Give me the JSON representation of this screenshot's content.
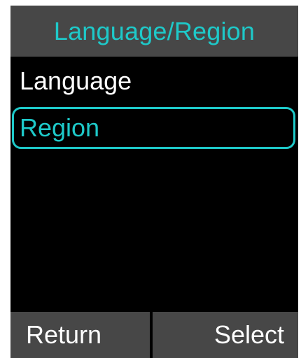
{
  "title": "Language/Region",
  "menu": {
    "items": [
      {
        "label": "Language",
        "selected": false
      },
      {
        "label": "Region",
        "selected": true
      }
    ]
  },
  "softkeys": {
    "left_label": "Return",
    "right_label": "Select"
  },
  "colors": {
    "accent": "#1ec9c9",
    "bar_background": "#474747",
    "screen_background": "#000000",
    "text": "#ffffff"
  }
}
